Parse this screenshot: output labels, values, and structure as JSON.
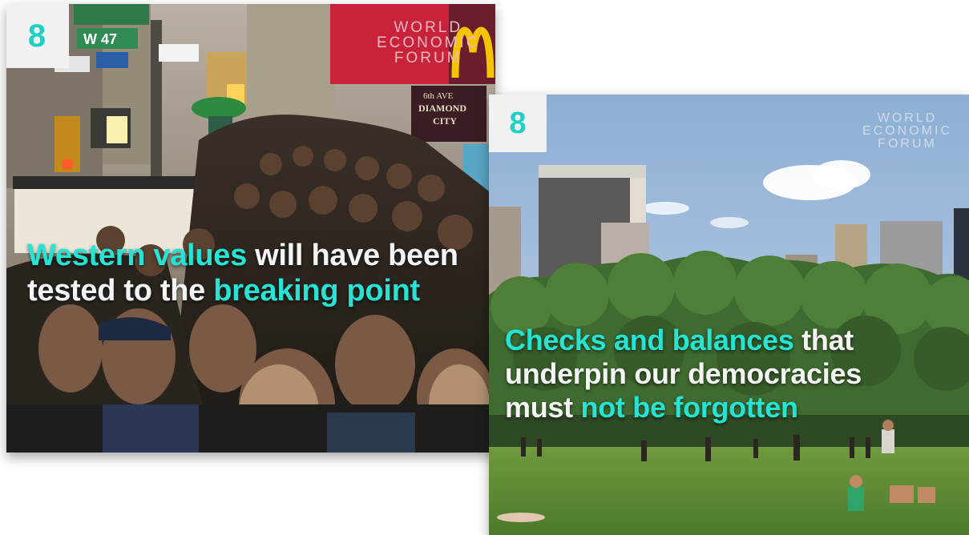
{
  "slide_left": {
    "number": "8",
    "caption": {
      "h1": "Western values",
      "t1": " will have been",
      "t2": "tested to the ",
      "h2": "breaking point"
    },
    "logo_lines": [
      "WORLD",
      "ECONOMIC",
      "FORUM"
    ],
    "signs": {
      "street1": "W 47",
      "store1": "6th AVE",
      "store2": "DIAMOND",
      "store3": "CITY"
    }
  },
  "slide_right": {
    "number": "8",
    "caption": {
      "h1": "Checks and balances",
      "t1": " that",
      "t2": "underpin our democracies",
      "t3": "must ",
      "h2": "not be forgotten"
    },
    "logo_lines": [
      "WORLD",
      "ECONOMIC",
      "FORUM"
    ]
  },
  "colors": {
    "accent_teal": "#27e3d3",
    "badge_bg": "#f1f1f1",
    "logo_red": "#c8233a",
    "mcd_yellow": "#f5c400"
  }
}
